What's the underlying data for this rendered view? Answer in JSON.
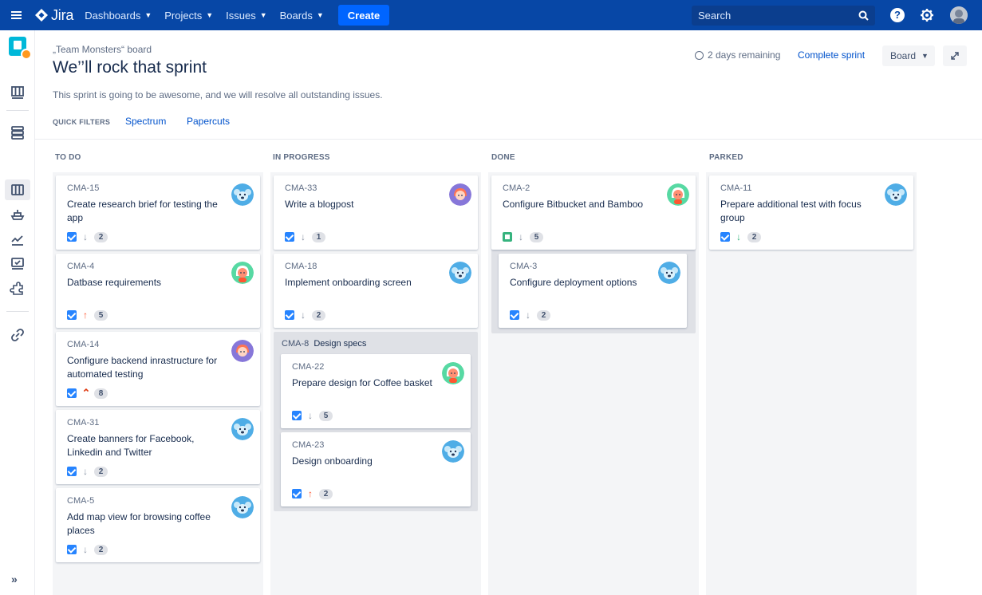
{
  "topbar": {
    "logo_text": "Jira",
    "menus": [
      "Dashboards",
      "Projects",
      "Issues",
      "Boards"
    ],
    "create_label": "Create",
    "search_placeholder": "Search",
    "help_label": "?"
  },
  "sidebar": {
    "expand_label": "»"
  },
  "header": {
    "board_name": "„Team Monsters“ board",
    "sprint_title": "We’’ll rock that sprint",
    "sprint_goal": "This sprint is going to be awesome, and we will resolve all outstanding issues.",
    "quick_filters_label": "QUICK FILTERS",
    "quick_filters": [
      "Spectrum",
      "Papercuts"
    ],
    "remaining": "2 days remaining",
    "complete_label": "Complete sprint",
    "board_button": "Board"
  },
  "columns": [
    {
      "title": "TO DO"
    },
    {
      "title": "IN PROGRESS"
    },
    {
      "title": "DONE"
    },
    {
      "title": "PARKED"
    }
  ],
  "cards": [
    {
      "key": "CMA-15",
      "summary": "Create research brief for testing the app",
      "type": "task",
      "priority": "low",
      "estimate": "2",
      "avatar": "koala"
    },
    {
      "key": "CMA-4",
      "summary": "Datbase requirements",
      "type": "task",
      "priority": "high",
      "estimate": "5",
      "avatar": "teal-girl"
    },
    {
      "key": "CMA-14",
      "summary": "Configure backend inrastructure for automated testing",
      "type": "task",
      "priority": "highest",
      "estimate": "8",
      "avatar": "purple-girl"
    },
    {
      "key": "CMA-31",
      "summary": "Create banners for Facebook, Linkedin and Twitter",
      "type": "task",
      "priority": "low",
      "estimate": "2",
      "avatar": "koala"
    },
    {
      "key": "CMA-5",
      "summary": "Add map view for browsing coffee places",
      "type": "task",
      "priority": "low",
      "estimate": "2",
      "avatar": "koala"
    },
    {
      "key": "CMA-33",
      "summary": "Write a blogpost",
      "type": "task",
      "priority": "low",
      "estimate": "1",
      "avatar": "purple-girl"
    },
    {
      "key": "CMA-18",
      "summary": "Implement onboarding screen",
      "type": "task",
      "priority": "low",
      "estimate": "2",
      "avatar": "koala"
    },
    {
      "key": "CMA-22",
      "summary": "Prepare design for Coffee basket",
      "type": "task",
      "priority": "low",
      "estimate": "5",
      "avatar": "teal-girl"
    },
    {
      "key": "CMA-23",
      "summary": "Design onboarding",
      "type": "task",
      "priority": "high",
      "estimate": "2",
      "avatar": "koala"
    },
    {
      "key": "CMA-2",
      "summary": "Configure Bitbucket and Bamboo",
      "type": "story",
      "priority": "low",
      "estimate": "5",
      "avatar": "teal-girl"
    },
    {
      "key": "CMA-3",
      "summary": "Configure deployment options",
      "type": "task",
      "priority": "low",
      "estimate": "2",
      "avatar": "koala"
    },
    {
      "key": "CMA-11",
      "summary": "Prepare additional test with focus group",
      "type": "task",
      "priority": "low-green",
      "estimate": "2",
      "avatar": "koala"
    }
  ],
  "subtask_group": {
    "key": "CMA-8",
    "title": "Design specs"
  },
  "colors": {
    "nav": "#0747A6",
    "create": "#0065FF",
    "link": "#0052CC",
    "column_bg": "#F4F5F7",
    "check": "#2684FF",
    "story": "#36B37E",
    "priority_high": "#FF5630"
  }
}
